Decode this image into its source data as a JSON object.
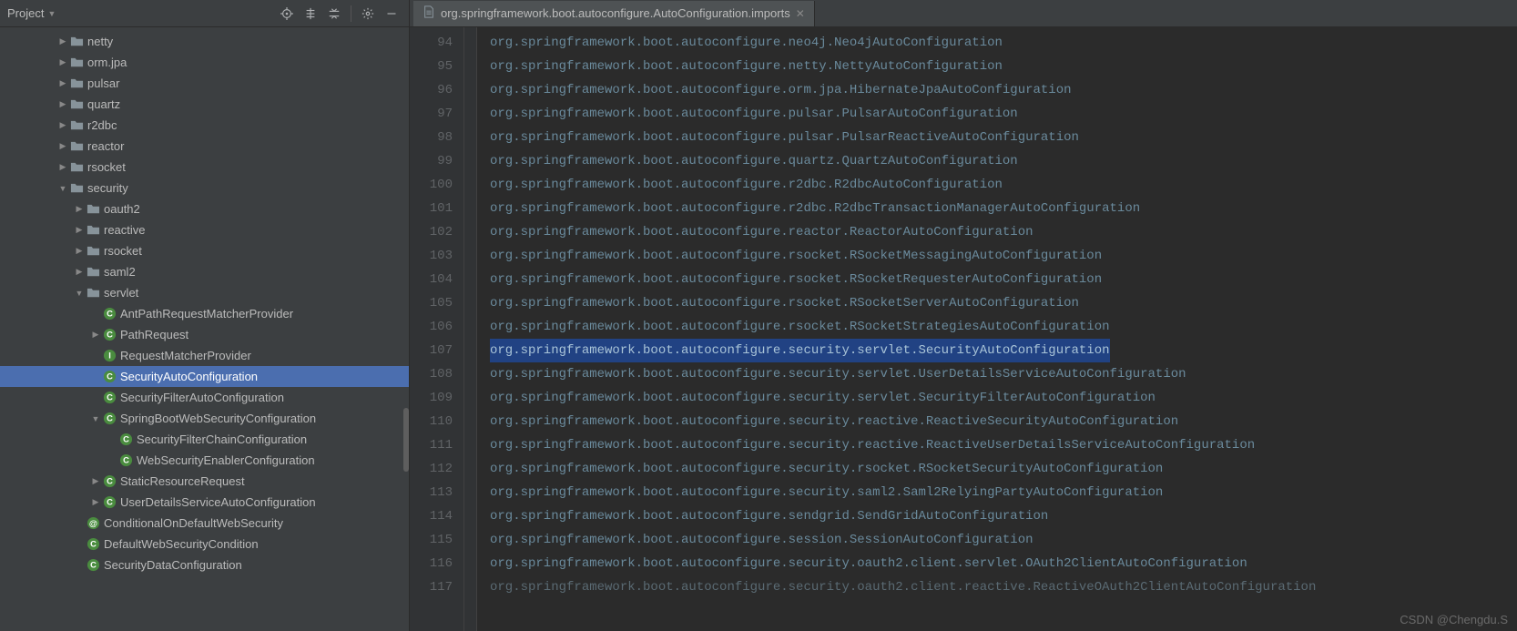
{
  "sidebar": {
    "title": "Project",
    "tree": [
      {
        "indent": 3,
        "arrow": "collapsed",
        "icon": "folder",
        "label": "netty"
      },
      {
        "indent": 3,
        "arrow": "collapsed",
        "icon": "folder",
        "label": "orm.jpa"
      },
      {
        "indent": 3,
        "arrow": "collapsed",
        "icon": "folder",
        "label": "pulsar"
      },
      {
        "indent": 3,
        "arrow": "collapsed",
        "icon": "folder",
        "label": "quartz"
      },
      {
        "indent": 3,
        "arrow": "collapsed",
        "icon": "folder",
        "label": "r2dbc"
      },
      {
        "indent": 3,
        "arrow": "collapsed",
        "icon": "folder",
        "label": "reactor"
      },
      {
        "indent": 3,
        "arrow": "collapsed",
        "icon": "folder",
        "label": "rsocket"
      },
      {
        "indent": 3,
        "arrow": "expanded",
        "icon": "folder",
        "label": "security"
      },
      {
        "indent": 4,
        "arrow": "collapsed",
        "icon": "folder",
        "label": "oauth2"
      },
      {
        "indent": 4,
        "arrow": "collapsed",
        "icon": "folder",
        "label": "reactive"
      },
      {
        "indent": 4,
        "arrow": "collapsed",
        "icon": "folder",
        "label": "rsocket"
      },
      {
        "indent": 4,
        "arrow": "collapsed",
        "icon": "folder",
        "label": "saml2"
      },
      {
        "indent": 4,
        "arrow": "expanded",
        "icon": "folder",
        "label": "servlet"
      },
      {
        "indent": 5,
        "arrow": "none",
        "icon": "class",
        "label": "AntPathRequestMatcherProvider"
      },
      {
        "indent": 5,
        "arrow": "collapsed",
        "icon": "class",
        "label": "PathRequest"
      },
      {
        "indent": 5,
        "arrow": "none",
        "icon": "class-i",
        "label": "RequestMatcherProvider"
      },
      {
        "indent": 5,
        "arrow": "none",
        "icon": "class",
        "label": "SecurityAutoConfiguration",
        "selected": true
      },
      {
        "indent": 5,
        "arrow": "none",
        "icon": "class",
        "label": "SecurityFilterAutoConfiguration"
      },
      {
        "indent": 5,
        "arrow": "expanded",
        "icon": "class",
        "label": "SpringBootWebSecurityConfiguration"
      },
      {
        "indent": 6,
        "arrow": "none",
        "icon": "class",
        "label": "SecurityFilterChainConfiguration"
      },
      {
        "indent": 6,
        "arrow": "none",
        "icon": "class",
        "label": "WebSecurityEnablerConfiguration"
      },
      {
        "indent": 5,
        "arrow": "collapsed",
        "icon": "class",
        "label": "StaticResourceRequest"
      },
      {
        "indent": 5,
        "arrow": "collapsed",
        "icon": "class",
        "label": "UserDetailsServiceAutoConfiguration"
      },
      {
        "indent": 4,
        "arrow": "none",
        "icon": "anno",
        "label": "ConditionalOnDefaultWebSecurity"
      },
      {
        "indent": 4,
        "arrow": "none",
        "icon": "class",
        "label": "DefaultWebSecurityCondition"
      },
      {
        "indent": 4,
        "arrow": "none",
        "icon": "class",
        "label": "SecurityDataConfiguration"
      }
    ]
  },
  "editor": {
    "tab": {
      "label": "org.springframework.boot.autoconfigure.AutoConfiguration.imports"
    },
    "startLine": 94,
    "highlightedLine": 107,
    "lines": [
      "org.springframework.boot.autoconfigure.neo4j.Neo4jAutoConfiguration",
      "org.springframework.boot.autoconfigure.netty.NettyAutoConfiguration",
      "org.springframework.boot.autoconfigure.orm.jpa.HibernateJpaAutoConfiguration",
      "org.springframework.boot.autoconfigure.pulsar.PulsarAutoConfiguration",
      "org.springframework.boot.autoconfigure.pulsar.PulsarReactiveAutoConfiguration",
      "org.springframework.boot.autoconfigure.quartz.QuartzAutoConfiguration",
      "org.springframework.boot.autoconfigure.r2dbc.R2dbcAutoConfiguration",
      "org.springframework.boot.autoconfigure.r2dbc.R2dbcTransactionManagerAutoConfiguration",
      "org.springframework.boot.autoconfigure.reactor.ReactorAutoConfiguration",
      "org.springframework.boot.autoconfigure.rsocket.RSocketMessagingAutoConfiguration",
      "org.springframework.boot.autoconfigure.rsocket.RSocketRequesterAutoConfiguration",
      "org.springframework.boot.autoconfigure.rsocket.RSocketServerAutoConfiguration",
      "org.springframework.boot.autoconfigure.rsocket.RSocketStrategiesAutoConfiguration",
      "org.springframework.boot.autoconfigure.security.servlet.SecurityAutoConfiguration",
      "org.springframework.boot.autoconfigure.security.servlet.UserDetailsServiceAutoConfiguration",
      "org.springframework.boot.autoconfigure.security.servlet.SecurityFilterAutoConfiguration",
      "org.springframework.boot.autoconfigure.security.reactive.ReactiveSecurityAutoConfiguration",
      "org.springframework.boot.autoconfigure.security.reactive.ReactiveUserDetailsServiceAutoConfiguration",
      "org.springframework.boot.autoconfigure.security.rsocket.RSocketSecurityAutoConfiguration",
      "org.springframework.boot.autoconfigure.security.saml2.Saml2RelyingPartyAutoConfiguration",
      "org.springframework.boot.autoconfigure.sendgrid.SendGridAutoConfiguration",
      "org.springframework.boot.autoconfigure.session.SessionAutoConfiguration",
      "org.springframework.boot.autoconfigure.security.oauth2.client.servlet.OAuth2ClientAutoConfiguration",
      "org.springframework.boot.autoconfigure.security.oauth2.client.reactive.ReactiveOAuth2ClientAutoConfiguration"
    ]
  },
  "watermark": "CSDN @Chengdu.S"
}
